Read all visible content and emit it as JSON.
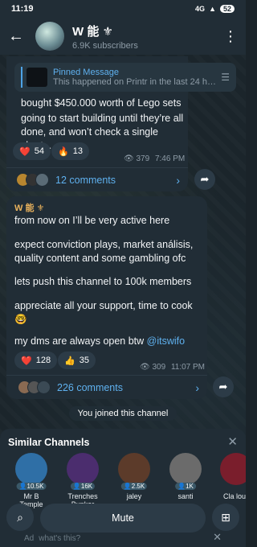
{
  "status": {
    "time": "11:19",
    "battery": "52",
    "signal": "4G"
  },
  "header": {
    "title": "W 能 ⚜",
    "subtitle": "6.9K subscribers"
  },
  "pinned": {
    "title": "Pinned Message",
    "text": "This happened on Printr in the last 24 ho..."
  },
  "post1": {
    "lines": [
      "bought $450.000 worth of Lego sets",
      "going to start building until they’re all done, and won’t check a single chart...."
    ],
    "reactions": [
      {
        "emoji": "❤️",
        "count": "54"
      },
      {
        "emoji": "🔥",
        "count": "13"
      }
    ],
    "views": "379",
    "time": "7:46 PM",
    "comments": "12 comments"
  },
  "post2": {
    "author": "W 能 ⚜",
    "paragraphs": [
      "from now on I’ll be very active here",
      "expect conviction plays, market análisis, quality content and some gambling ofc",
      "lets push this channel to 100k members",
      "appreciate all your support, time to cook 🤓",
      "my dms are always open btw"
    ],
    "handle": "@itswifo",
    "reactions": [
      {
        "emoji": "❤️",
        "count": "128"
      },
      {
        "emoji": "👍",
        "count": "35"
      }
    ],
    "views": "309",
    "time": "11:07 PM",
    "comments": "226 comments"
  },
  "service": {
    "joined": "You joined this channel"
  },
  "similar": {
    "title": "Similar Channels",
    "channels": [
      {
        "name": "Mr B Temple",
        "count": "10.5K",
        "color": "#2f6fa6"
      },
      {
        "name": "Trenches Bunker",
        "count": "16K",
        "color": "#4b2d6e"
      },
      {
        "name": "jaley",
        "count": "2.5K",
        "color": "#5c3b2a"
      },
      {
        "name": "santi",
        "count": "1K",
        "color": "#6b6b6b"
      },
      {
        "name": "Cla lou",
        "count": "",
        "color": "#7a1e2c"
      }
    ]
  },
  "bottom": {
    "mute": "Mute",
    "ad_label": "Ad",
    "ad_text": "what's this?"
  }
}
